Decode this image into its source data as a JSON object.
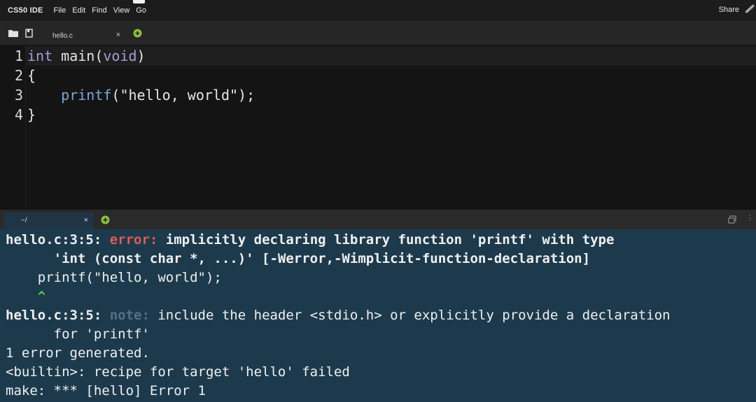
{
  "menubar": {
    "brand": "CS50 IDE",
    "items": [
      "File",
      "Edit",
      "Find",
      "View",
      "Go"
    ],
    "share_label": "Share"
  },
  "editor": {
    "tab_label": "hello.c",
    "close_glyph": "×",
    "line_numbers": [
      "1",
      "2",
      "3",
      "4"
    ],
    "code": {
      "l1_kw": "int",
      "l1_name": " main(",
      "l1_arg": "void",
      "l1_end": ")",
      "l2": "{",
      "l3_indent": "    ",
      "l3_fn": "printf",
      "l3_rest": "(\"hello, world\");",
      "l4": "}"
    }
  },
  "terminal": {
    "tab_label": "~/",
    "close_glyph": "×",
    "line1": {
      "loc": "hello.c:3:5: ",
      "level": "error:",
      "msg": " implicitly declaring library function 'printf' with type"
    },
    "line2": "      'int (const char *, ...)' [-Werror,-Wimplicit-function-declaration]",
    "line3": "    printf(\"hello, world\");",
    "line4": "    ^",
    "line5": {
      "loc": "hello.c:3:5: ",
      "level": "note:",
      "msg": " include the header <stdio.h> or explicitly provide a declaration"
    },
    "line6": "      for 'printf'",
    "line7": "1 error generated.",
    "line8": "<builtin>: recipe for target 'hello' failed",
    "line9": "make: *** [hello] Error 1"
  },
  "colors": {
    "terminal_bg": "#1d3a4d",
    "error": "#e05a55",
    "note": "#56707f",
    "caret": "#4fd24f",
    "keyword": "#a79cdc",
    "function": "#7fa7d8"
  }
}
